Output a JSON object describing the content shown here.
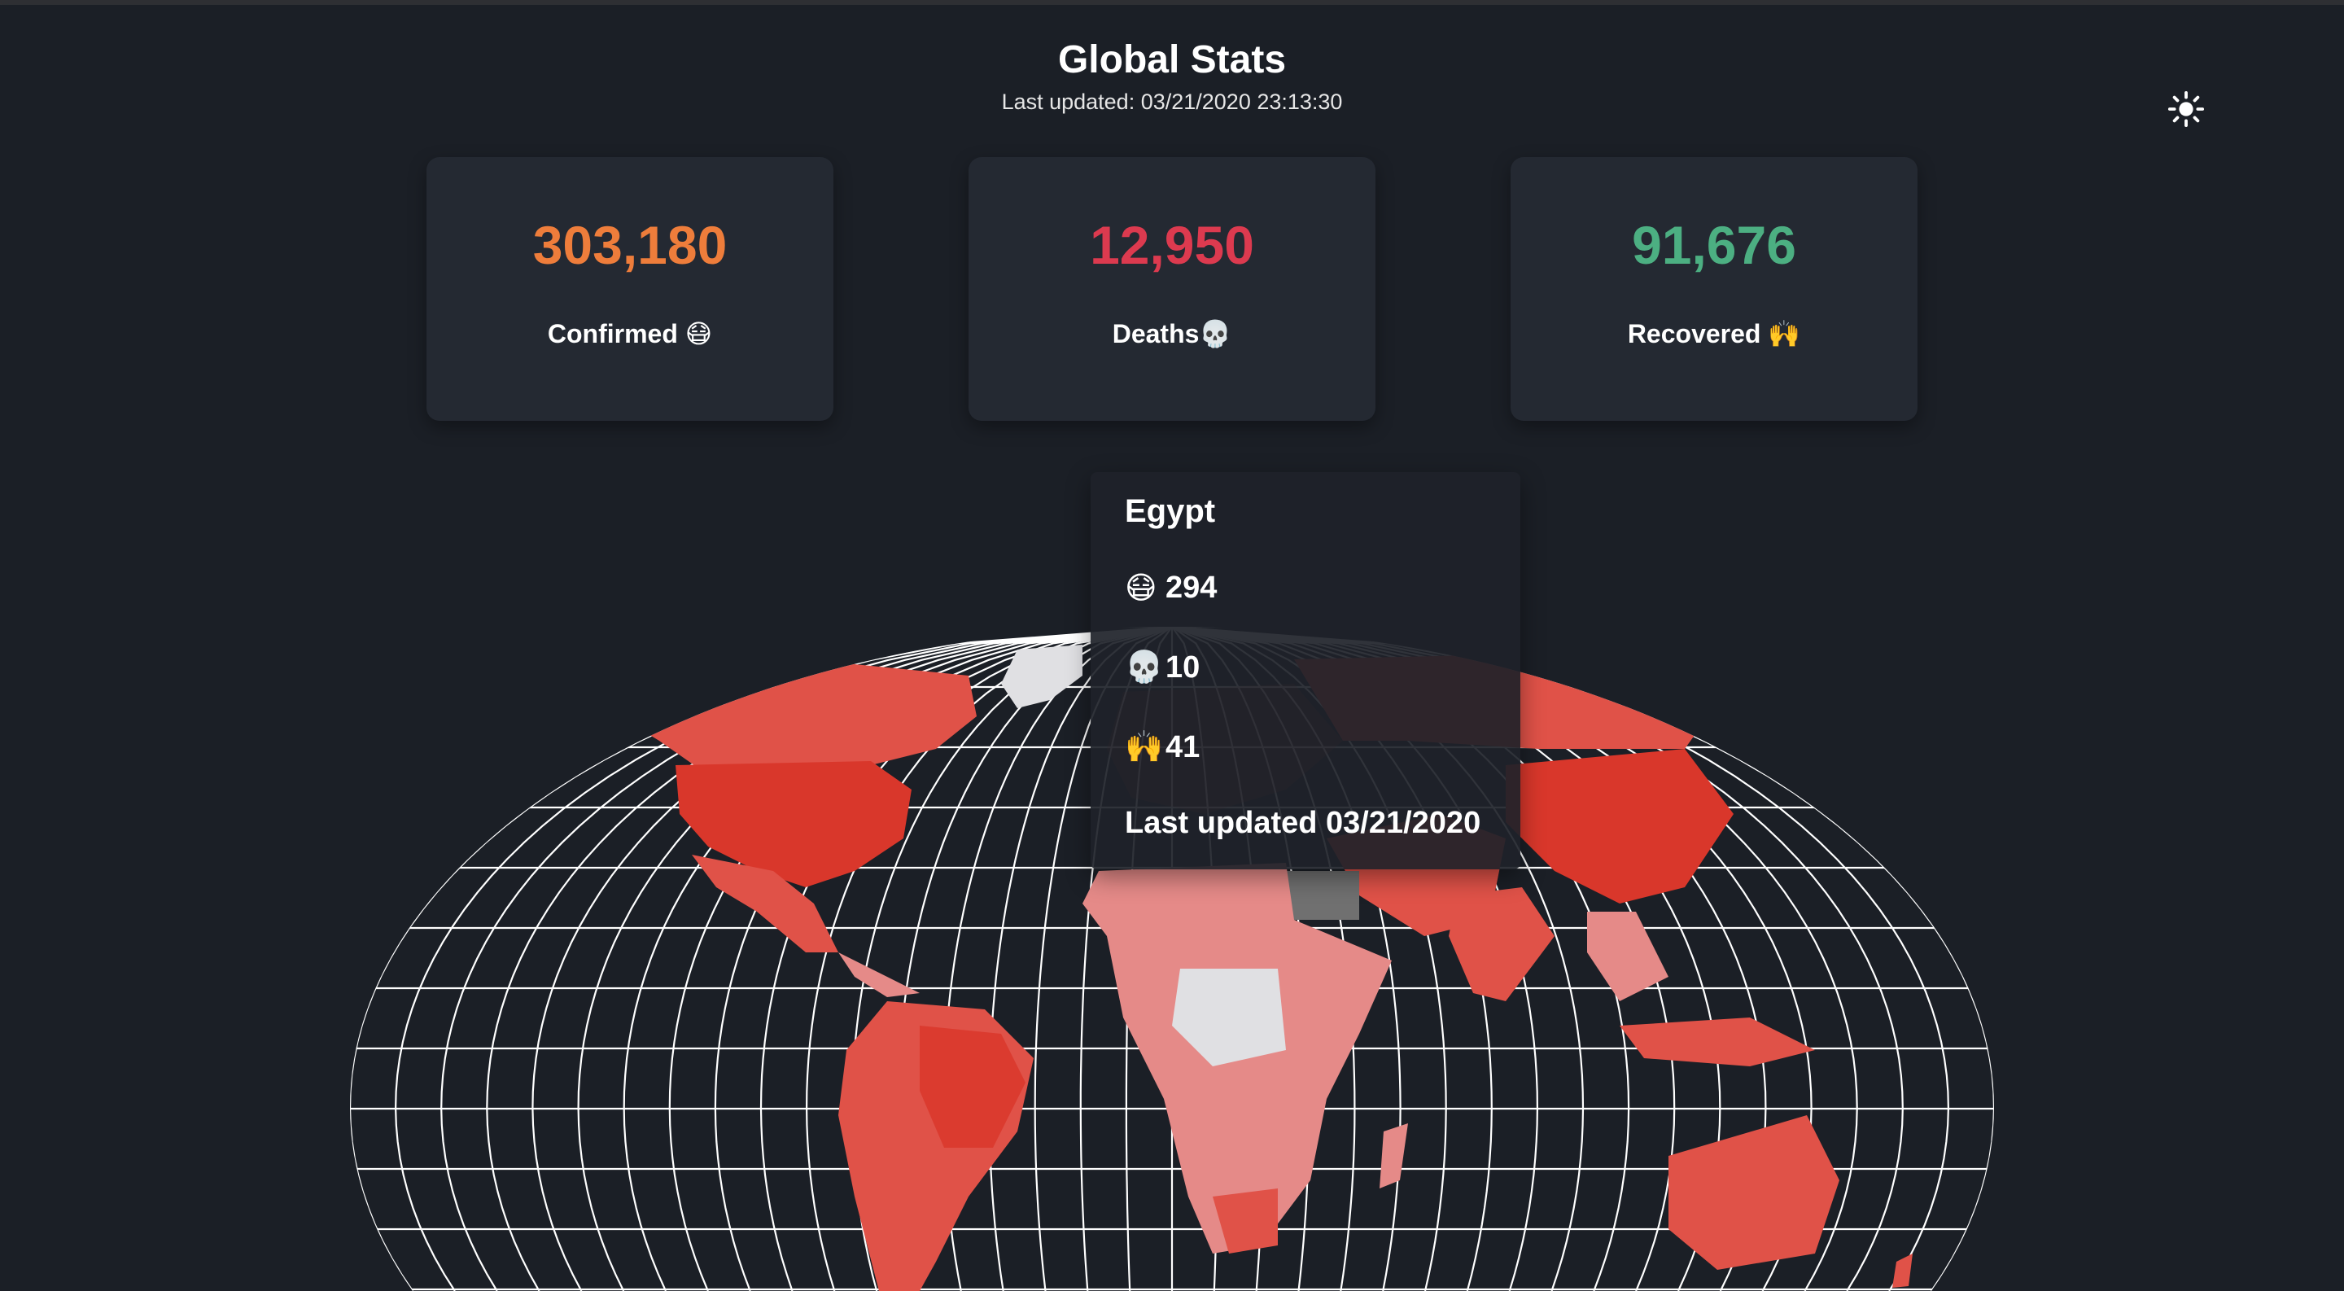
{
  "header": {
    "title": "Global Stats",
    "last_updated": "Last updated: 03/21/2020 23:13:30"
  },
  "theme_toggle": {
    "icon": "sun-icon"
  },
  "cards": [
    {
      "value": "303,180",
      "label": "Confirmed 😷",
      "color": "#ee7d3b"
    },
    {
      "value": "12,950",
      "label": "Deaths💀",
      "color": "#dc3a4f"
    },
    {
      "value": "91,676",
      "label": "Recovered 🙌",
      "color": "#4caf82"
    }
  ],
  "tooltip": {
    "country": "Egypt",
    "confirmed_icon": "😷",
    "confirmed": "294",
    "deaths_icon": "💀",
    "deaths": "10",
    "recovered_icon": "🙌",
    "recovered": "41",
    "updated": "Last updated 03/21/2020"
  },
  "map": {
    "grid_color": "#ffffff",
    "fill_colors": [
      "#d9372b",
      "#e05248",
      "#e58a88",
      "#e0e0e3"
    ]
  }
}
